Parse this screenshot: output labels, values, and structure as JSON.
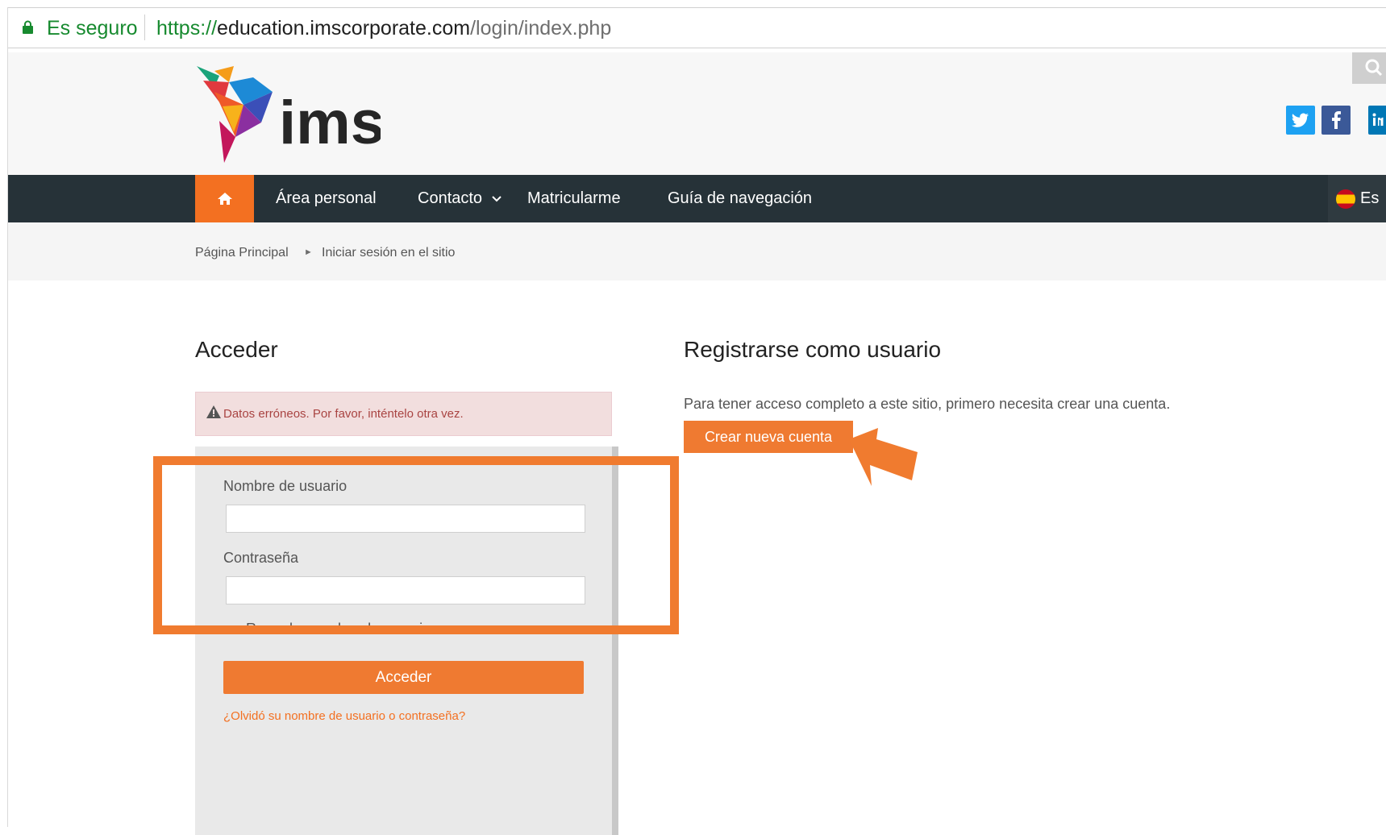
{
  "browser": {
    "secure_label": "Es seguro",
    "url_scheme": "https://",
    "url_host": "education.imscorporate.com",
    "url_path": "/login/index.php"
  },
  "header": {
    "logo_alt": "ims",
    "search_icon": "search-icon",
    "social": [
      "twitter-icon",
      "facebook-icon",
      "linkedin-icon"
    ]
  },
  "nav": {
    "home_icon": "home-icon",
    "items": [
      {
        "label": "Área personal"
      },
      {
        "label": "Contacto"
      },
      {
        "label": "Matricularme"
      },
      {
        "label": "Guía de navegación"
      }
    ],
    "language": "Es"
  },
  "breadcrumb": {
    "items": [
      "Página Principal",
      "Iniciar sesión en el sitio"
    ],
    "separator": "►"
  },
  "login": {
    "title": "Acceder",
    "error": "Datos erróneos. Por favor, inténtelo otra vez.",
    "username_label": "Nombre de usuario",
    "username_value": "",
    "password_label": "Contraseña",
    "password_value": "",
    "remember_label": "Recordar nombre de usuario",
    "submit_label": "Acceder",
    "forgot_link": "¿Olvidó su nombre de usuario o contraseña?"
  },
  "register": {
    "title": "Registrarse como usuario",
    "text": "Para tener acceso completo a este sitio, primero necesita crear una cuenta.",
    "button_label": "Crear nueva cuenta"
  },
  "colors": {
    "accent": "#f37021",
    "nav_bg": "#263238",
    "annotation": "#f07b2f"
  }
}
